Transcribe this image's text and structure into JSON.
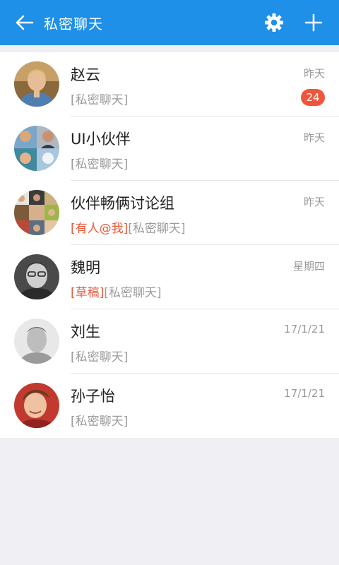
{
  "header": {
    "title": "私密聊天",
    "back_icon": "back-arrow-icon",
    "settings_icon": "gear-icon",
    "add_icon": "plus-icon",
    "bg_color": "#1e90e8"
  },
  "chats": [
    {
      "name": "赵云",
      "time": "昨天",
      "preview_tag": "",
      "preview_text": "[私密聊天]",
      "badge": "24"
    },
    {
      "name": "UI小伙伴",
      "time": "昨天",
      "preview_tag": "",
      "preview_text": "[私密聊天]",
      "badge": ""
    },
    {
      "name": "伙伴畅俩讨论组",
      "time": "昨天",
      "preview_tag": "[有人@我]",
      "preview_text": "[私密聊天]",
      "badge": ""
    },
    {
      "name": "魏明",
      "time": "星期四",
      "preview_tag": "[草稿]",
      "preview_text": "[私密聊天]",
      "badge": ""
    },
    {
      "name": "刘生",
      "time": "17/1/21",
      "preview_tag": "",
      "preview_text": "[私密聊天]",
      "badge": ""
    },
    {
      "name": "孙子怡",
      "time": "17/1/21",
      "preview_tag": "",
      "preview_text": "[私密聊天]",
      "badge": ""
    }
  ],
  "colors": {
    "accent": "#1e90e8",
    "badge": "#f0553b",
    "tag": "#e85a3a"
  }
}
